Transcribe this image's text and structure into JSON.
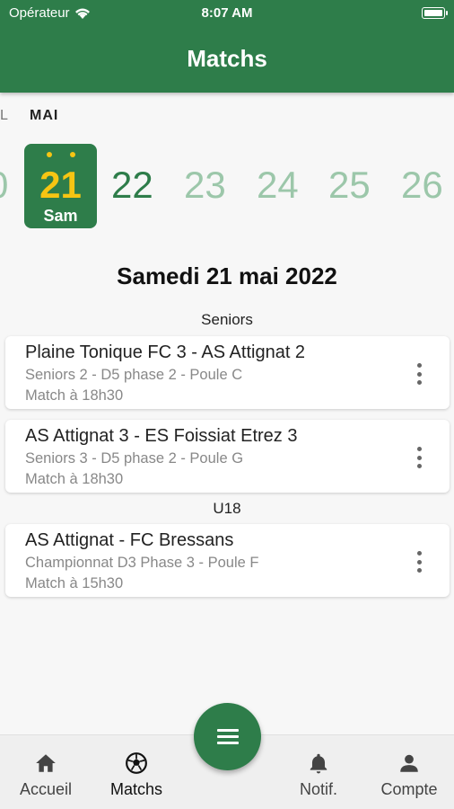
{
  "status_bar": {
    "carrier": "Opérateur",
    "time": "8:07 AM"
  },
  "header": {
    "title": "Matchs"
  },
  "calendar": {
    "prev_month": "L",
    "month": "MAI",
    "prev_day": "0",
    "selected": {
      "day": "21",
      "weekday": "Sam"
    },
    "days": [
      "22",
      "23",
      "24",
      "25",
      "26"
    ]
  },
  "date_title": "Samedi 21 mai 2022",
  "groups": [
    {
      "label": "Seniors",
      "matches": [
        {
          "title": "Plaine Tonique FC 3 - AS Attignat 2",
          "competition": "Seniors 2 - D5 phase 2 - Poule C",
          "time": "Match à 18h30"
        },
        {
          "title": "AS Attignat 3 - ES Foissiat Etrez 3",
          "competition": "Seniors 3 - D5 phase 2 - Poule G",
          "time": "Match à 18h30"
        }
      ]
    },
    {
      "label": "U18",
      "matches": [
        {
          "title": "AS Attignat - FC Bressans",
          "competition": "Championnat D3 Phase 3 - Poule F",
          "time": "Match à 15h30"
        }
      ]
    }
  ],
  "bottom_nav": {
    "items": [
      {
        "label": "Accueil",
        "icon": "home-icon"
      },
      {
        "label": "Matchs",
        "icon": "soccer-ball-icon"
      },
      {
        "label": "Notif.",
        "icon": "bell-icon"
      },
      {
        "label": "Compte",
        "icon": "person-icon"
      }
    ],
    "fab_icon": "menu-icon"
  },
  "colors": {
    "primary": "#2e7d4a",
    "accent": "#f6c513",
    "muted_day": "#9cc7aa"
  }
}
